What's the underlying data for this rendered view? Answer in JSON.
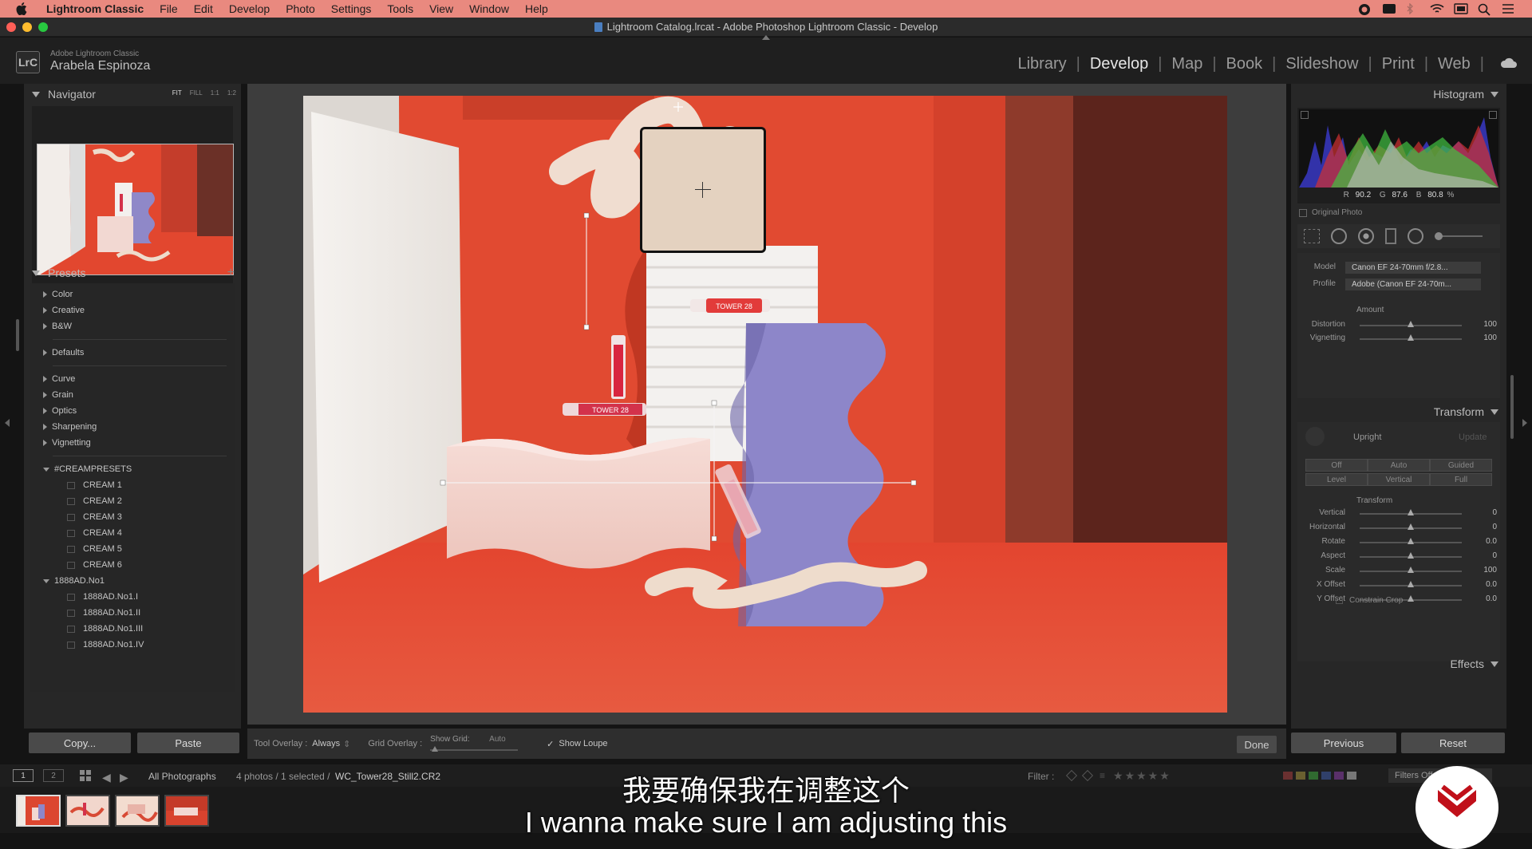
{
  "menubar": {
    "app": "Lightroom Classic",
    "items": [
      "File",
      "Edit",
      "Develop",
      "Photo",
      "Settings",
      "Tools",
      "View",
      "Window",
      "Help"
    ]
  },
  "window_title": "Lightroom Catalog.lrcat - Adobe Photoshop Lightroom Classic - Develop",
  "identity": {
    "badge": "LrC",
    "product": "Adobe Lightroom Classic",
    "user": "Arabela Espinoza"
  },
  "modules": [
    "Library",
    "Develop",
    "Map",
    "Book",
    "Slideshow",
    "Print",
    "Web"
  ],
  "active_module": "Develop",
  "navigator": {
    "title": "Navigator",
    "options": [
      "FIT",
      "FILL",
      "1:1",
      "1:2"
    ]
  },
  "presets": {
    "title": "Presets",
    "add": "+",
    "groups_a": [
      "Color",
      "Creative",
      "B&W"
    ],
    "groups_b": [
      "Defaults"
    ],
    "groups_c": [
      "Curve",
      "Grain",
      "Optics",
      "Sharpening",
      "Vignetting"
    ],
    "folder1": "#CREAMPRESETS",
    "folder1_items": [
      "CREAM 1",
      "CREAM 2",
      "CREAM 3",
      "CREAM 4",
      "CREAM 5",
      "CREAM 6"
    ],
    "folder2": "1888AD.No1",
    "folder2_items": [
      "1888AD.No1.I",
      "1888AD.No1.II",
      "1888AD.No1.III",
      "1888AD.No1.IV"
    ]
  },
  "left_buttons": {
    "copy": "Copy...",
    "paste": "Paste"
  },
  "toolbar": {
    "tool_overlay_label": "Tool Overlay :",
    "tool_overlay_value": "Always",
    "grid_overlay_label": "Grid Overlay :",
    "show_grid_label": "Show Grid:",
    "show_grid_value": "Auto",
    "show_loupe": "Show Loupe",
    "done": "Done"
  },
  "histogram": {
    "title": "Histogram",
    "r_label": "R",
    "r": "90.2",
    "g_label": "G",
    "g": "87.6",
    "b_label": "B",
    "b": "80.8",
    "unit": "%",
    "original_photo": "Original Photo"
  },
  "lens": {
    "model_label": "Model",
    "model": "Canon EF 24-70mm f/2.8...",
    "profile_label": "Profile",
    "profile": "Adobe (Canon EF 24-70m...",
    "amount": "Amount",
    "sliders": [
      {
        "label": "Distortion",
        "value": "100",
        "pos": 0.5
      },
      {
        "label": "Vignetting",
        "value": "100",
        "pos": 0.5
      }
    ]
  },
  "transform": {
    "title": "Transform",
    "upright": "Upright",
    "update": "Update",
    "buttons_row1": [
      "Off",
      "Auto",
      "Guided"
    ],
    "buttons_row2": [
      "Level",
      "Vertical",
      "Full"
    ],
    "sub": "Transform",
    "sliders": [
      {
        "label": "Vertical",
        "value": "0",
        "pos": 0.5
      },
      {
        "label": "Horizontal",
        "value": "0",
        "pos": 0.5
      },
      {
        "label": "Rotate",
        "value": "0.0",
        "pos": 0.5
      },
      {
        "label": "Aspect",
        "value": "0",
        "pos": 0.5
      },
      {
        "label": "Scale",
        "value": "100",
        "pos": 0.5
      },
      {
        "label": "X Offset",
        "value": "0.0",
        "pos": 0.5
      },
      {
        "label": "Y Offset",
        "value": "0.0",
        "pos": 0.5
      }
    ],
    "constrain": "Constrain Crop"
  },
  "effects": {
    "title": "Effects"
  },
  "right_buttons": {
    "previous": "Previous",
    "reset": "Reset"
  },
  "filmbar": {
    "screen1": "1",
    "screen2": "2",
    "source": "All Photographs",
    "count": "4 photos / 1 selected /",
    "filename": "WC_Tower28_Still2.CR2",
    "filter": "Filter :",
    "filters_off": "Filters Off"
  },
  "subtitles": {
    "cn": "我要确保我在调整这个",
    "en": "I wanna make sure I am adjusting this"
  },
  "product_label": "TOWER 28",
  "colors": {
    "accent": "#e9897f",
    "photo_bg": "#e04630",
    "purple": "#8d86c9"
  }
}
